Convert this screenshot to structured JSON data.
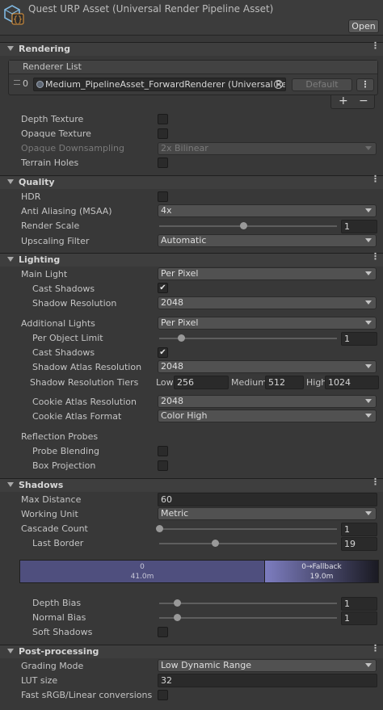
{
  "header": {
    "title": "Quest URP Asset (Universal Render Pipeline Asset)",
    "open_label": "Open"
  },
  "sections": {
    "rendering": "Rendering",
    "quality": "Quality",
    "lighting": "Lighting",
    "shadows": "Shadows",
    "post": "Post-processing"
  },
  "rendering": {
    "renderer_list_label": "Renderer List",
    "renderer_index": "0",
    "renderer_value": "Medium_PipelineAsset_ForwardRenderer (Universal Ren",
    "default_label": "Default",
    "add_label": "+",
    "remove_label": "−",
    "depth_texture": "Depth Texture",
    "opaque_texture": "Opaque Texture",
    "opaque_downsampling": "Opaque Downsampling",
    "opaque_downsampling_value": "2x Bilinear",
    "terrain_holes": "Terrain Holes"
  },
  "quality": {
    "hdr": "HDR",
    "msaa": "Anti Aliasing (MSAA)",
    "msaa_value": "4x",
    "render_scale": "Render Scale",
    "render_scale_value": "1",
    "upscaling": "Upscaling Filter",
    "upscaling_value": "Automatic"
  },
  "lighting": {
    "main_light": "Main Light",
    "main_light_value": "Per Pixel",
    "cast_shadows": "Cast Shadows",
    "shadow_resolution": "Shadow Resolution",
    "shadow_resolution_value": "2048",
    "additional_lights": "Additional Lights",
    "additional_lights_value": "Per Pixel",
    "per_object_limit": "Per Object Limit",
    "per_object_limit_value": "1",
    "add_cast_shadows": "Cast Shadows",
    "atlas_resolution": "Shadow Atlas Resolution",
    "atlas_resolution_value": "2048",
    "tiers": "Shadow Resolution Tiers",
    "tier_low_label": "Low",
    "tier_low_value": "256",
    "tier_medium_label": "Medium",
    "tier_medium_value": "512",
    "tier_high_label": "High",
    "tier_high_value": "1024",
    "cookie_resolution": "Cookie Atlas Resolution",
    "cookie_resolution_value": "2048",
    "cookie_format": "Cookie Atlas Format",
    "cookie_format_value": "Color High",
    "reflection_probes": "Reflection Probes",
    "probe_blending": "Probe Blending",
    "box_projection": "Box Projection"
  },
  "shadows": {
    "max_distance": "Max Distance",
    "max_distance_value": "60",
    "working_unit": "Working Unit",
    "working_unit_value": "Metric",
    "cascade_count": "Cascade Count",
    "cascade_count_value": "1",
    "last_border": "Last Border",
    "last_border_value": "19",
    "cascade0_index": "0",
    "cascade0_dist": "41.0m",
    "fallback_label": "0→Fallback",
    "fallback_dist": "19.0m",
    "depth_bias": "Depth Bias",
    "depth_bias_value": "1",
    "normal_bias": "Normal Bias",
    "normal_bias_value": "1",
    "soft_shadows": "Soft Shadows"
  },
  "post": {
    "grading_mode": "Grading Mode",
    "grading_mode_value": "Low Dynamic Range",
    "lut_size": "LUT size",
    "lut_size_value": "32",
    "fast_srgb": "Fast sRGB/Linear conversions"
  },
  "state": {
    "depth_texture": false,
    "opaque_texture": false,
    "terrain_holes": false,
    "hdr": false,
    "main_cast_shadows": true,
    "add_cast_shadows": true,
    "probe_blending": false,
    "box_projection": false,
    "soft_shadows": false,
    "fast_srgb": false,
    "render_scale": 1.0,
    "per_object_limit": 1,
    "cascade_count": 1,
    "last_border": 19,
    "depth_bias": 1,
    "normal_bias": 1
  },
  "colors": {
    "cascade0": "#4f4f7e",
    "fallback_start": "#7d7dc0",
    "fallback_end": "#1a1a22",
    "icon_accent": "#e89a3c",
    "icon_frame": "#7fb7e0"
  },
  "icons": [
    "urp-asset-icon",
    "foldout-arrow-icon",
    "kebab-menu-icon",
    "checkmark-icon",
    "dropdown-arrow-icon",
    "drag-handle-icon",
    "object-picker-icon"
  ]
}
